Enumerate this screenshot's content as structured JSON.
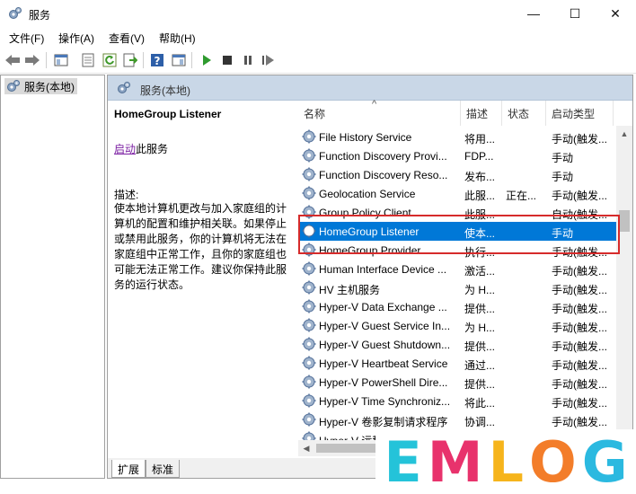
{
  "window": {
    "title": "服务",
    "minimize": "—",
    "maximize": "☐",
    "close": "✕"
  },
  "menu": [
    "文件(F)",
    "操作(A)",
    "查看(V)",
    "帮助(H)"
  ],
  "tree": {
    "root": "服务(本地)"
  },
  "pane": {
    "title": "服务(本地)"
  },
  "detail": {
    "service_name": "HomeGroup Listener",
    "start_link": "启动",
    "start_suffix": "此服务",
    "desc_label": "描述:",
    "desc_text": "使本地计算机更改与加入家庭组的计算机的配置和维护相关联。如果停止或禁用此服务，你的计算机将无法在家庭组中正常工作，且你的家庭组也可能无法正常工作。建议你保持此服务的运行状态。"
  },
  "columns": {
    "name": "名称",
    "desc": "描述",
    "status": "状态",
    "startup": "启动类型"
  },
  "services": [
    {
      "name": "File History Service",
      "desc": "将用...",
      "status": "",
      "startup": "手动(触发..."
    },
    {
      "name": "Function Discovery Provi...",
      "desc": "FDP...",
      "status": "",
      "startup": "手动"
    },
    {
      "name": "Function Discovery Reso...",
      "desc": "发布...",
      "status": "",
      "startup": "手动"
    },
    {
      "name": "Geolocation Service",
      "desc": "此服...",
      "status": "正在...",
      "startup": "手动(触发..."
    },
    {
      "name": "Group Policy Client",
      "desc": "此服...",
      "status": "",
      "startup": "自动(触发..."
    },
    {
      "name": "HomeGroup Listener",
      "desc": "使本...",
      "status": "",
      "startup": "手动"
    },
    {
      "name": "HomeGroup Provider",
      "desc": "执行...",
      "status": "",
      "startup": "手动(触发..."
    },
    {
      "name": "Human Interface Device ...",
      "desc": "激活...",
      "status": "",
      "startup": "手动(触发..."
    },
    {
      "name": "HV 主机服务",
      "desc": "为 H...",
      "status": "",
      "startup": "手动(触发..."
    },
    {
      "name": "Hyper-V Data Exchange ...",
      "desc": "提供...",
      "status": "",
      "startup": "手动(触发..."
    },
    {
      "name": "Hyper-V Guest Service In...",
      "desc": "为 H...",
      "status": "",
      "startup": "手动(触发..."
    },
    {
      "name": "Hyper-V Guest Shutdown...",
      "desc": "提供...",
      "status": "",
      "startup": "手动(触发..."
    },
    {
      "name": "Hyper-V Heartbeat Service",
      "desc": "通过...",
      "status": "",
      "startup": "手动(触发..."
    },
    {
      "name": "Hyper-V PowerShell Dire...",
      "desc": "提供...",
      "status": "",
      "startup": "手动(触发..."
    },
    {
      "name": "Hyper-V Time Synchroniz...",
      "desc": "将此...",
      "status": "",
      "startup": "手动(触发..."
    },
    {
      "name": "Hyper-V 卷影复制请求程序",
      "desc": "协调...",
      "status": "",
      "startup": "手动(触发..."
    },
    {
      "name": "Hyper-V 远程桌面虚拟化...",
      "desc": "提供...",
      "status": "",
      "startup": "手动(触发..."
    }
  ],
  "selected_index": 5,
  "tabs": [
    "扩展",
    "标准"
  ],
  "watermark": {
    "letters": [
      "E",
      "M",
      "L",
      "O",
      "G"
    ],
    "colors": [
      "#24c3d9",
      "#e8326c",
      "#f6b41b",
      "#f37d2a",
      "#2bb9e0"
    ]
  },
  "accent": "#0078d7"
}
